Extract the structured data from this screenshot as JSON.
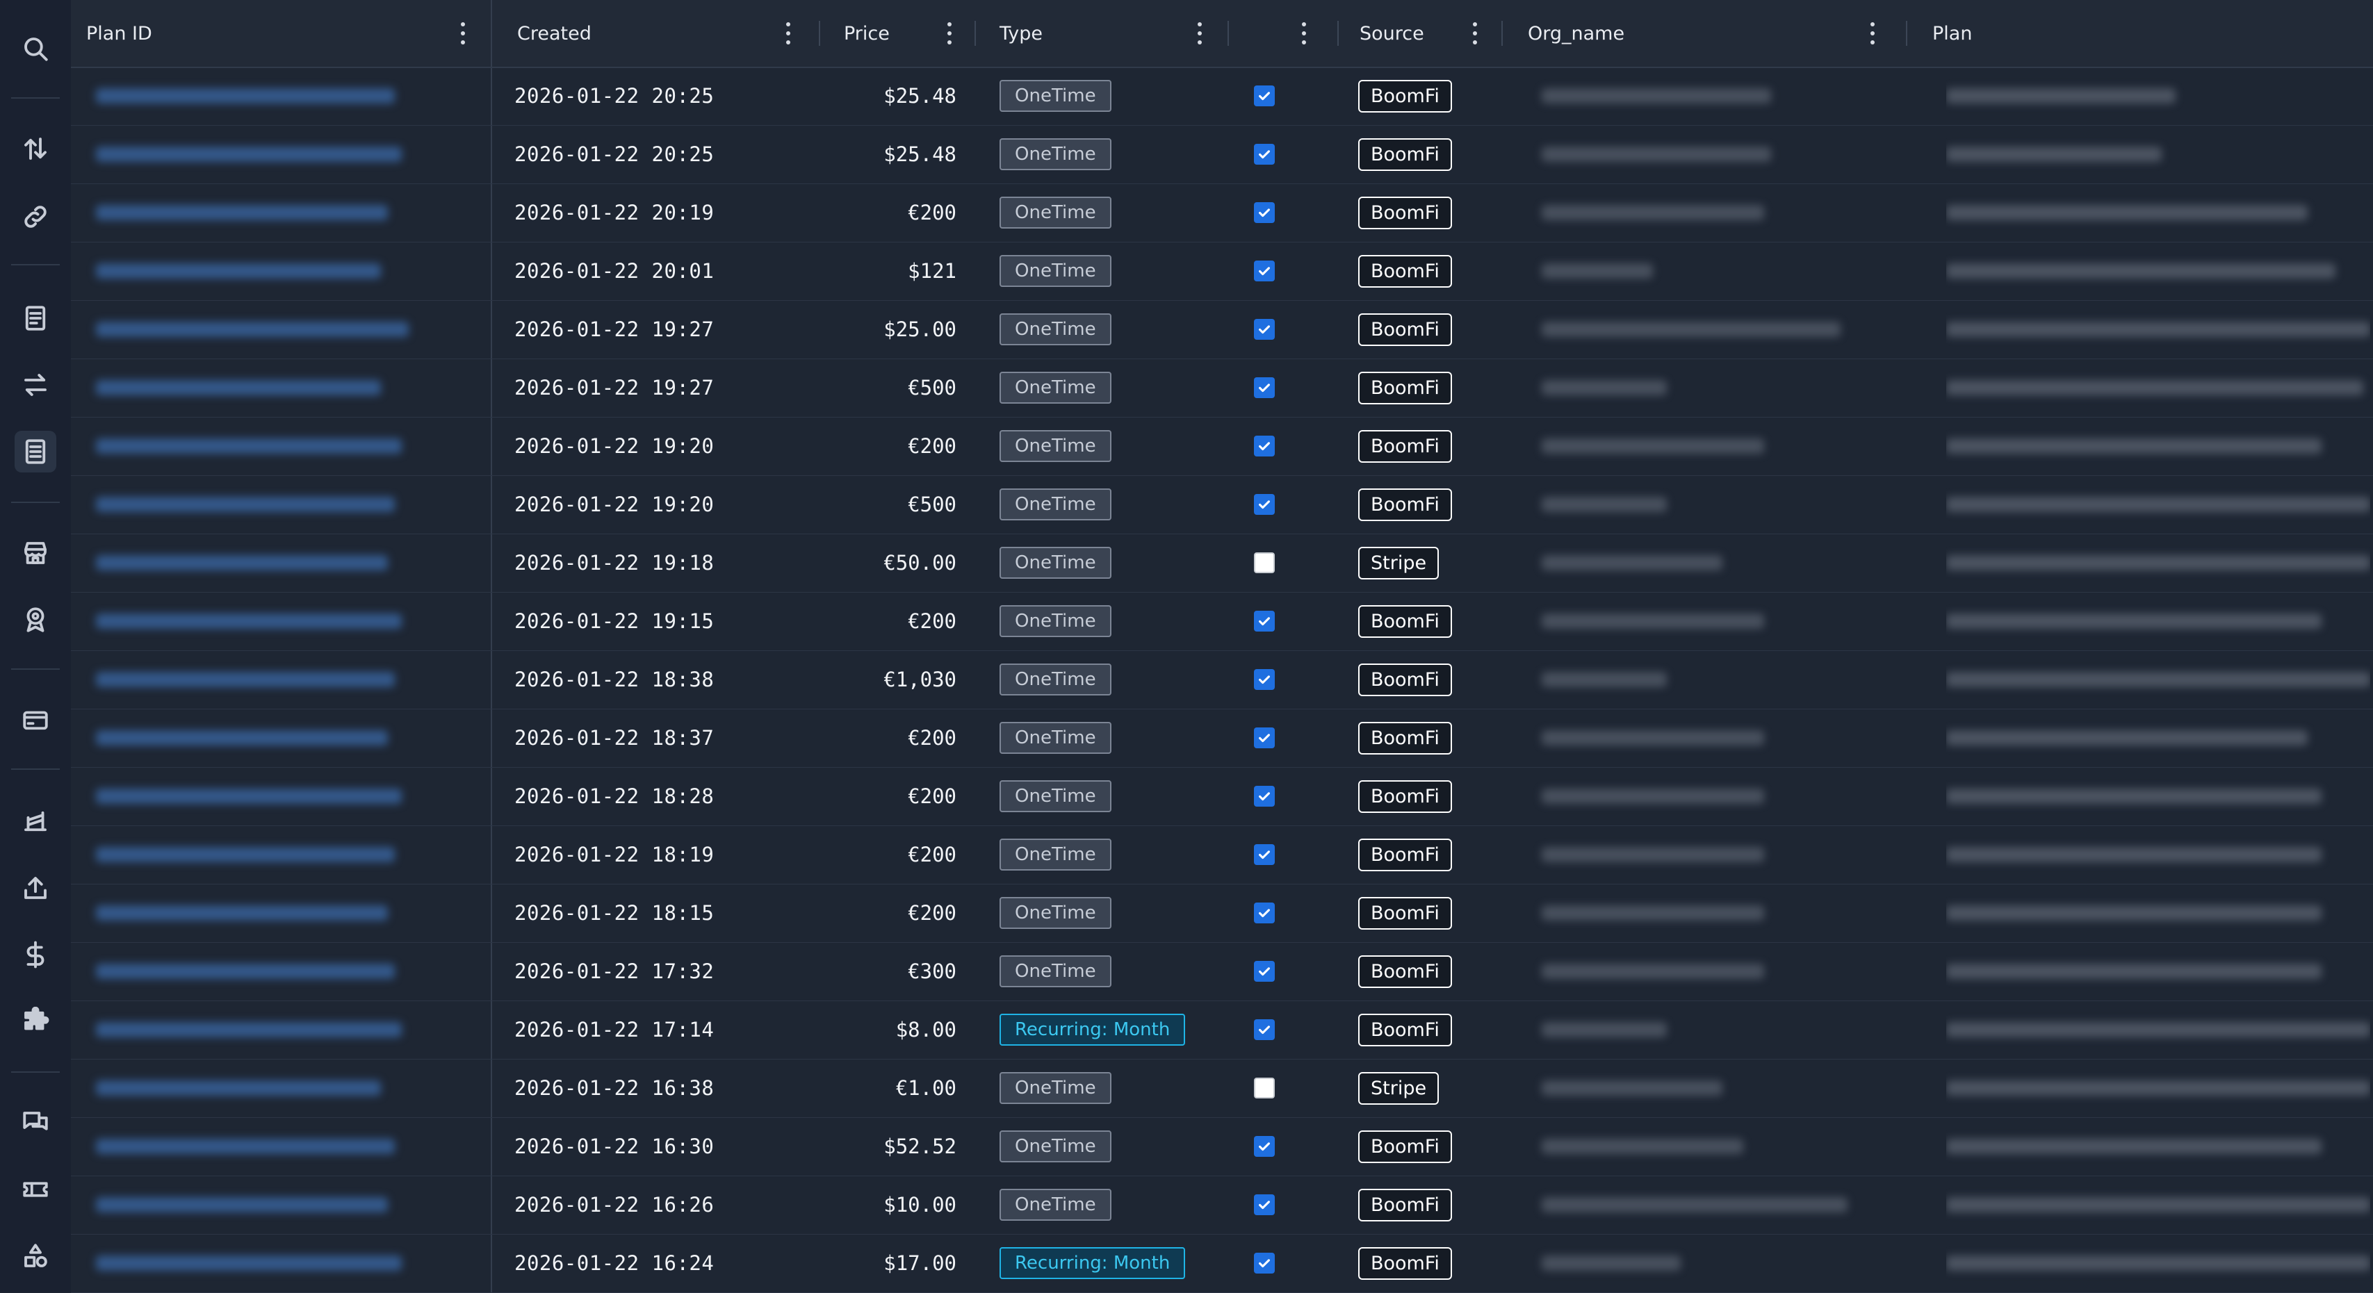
{
  "rail": {
    "icons": [
      "search-icon",
      "sort-arrows-icon",
      "link-icon",
      "invoice-icon",
      "swap-icon",
      "receipt-icon",
      "store-icon",
      "badge-icon",
      "card-icon",
      "stack-icon",
      "upload-icon",
      "dollar-icon",
      "puzzle-icon",
      "chat-icon",
      "ticket-icon",
      "shapes-icon"
    ]
  },
  "columns": {
    "plan_id": "Plan ID",
    "created": "Created",
    "price": "Price",
    "type": "Type",
    "checked": "",
    "source": "Source",
    "org_name": "Org_name",
    "plan": "Plan"
  },
  "colors": {
    "background": "#1e2633",
    "recurring_accent": "#1fb4e6",
    "checkbox_blue": "#1f6fe0"
  },
  "rows": [
    {
      "created": "2026-01-22 20:25",
      "price": "$25.48",
      "type": "OneTime",
      "checked": true,
      "source": "BoomFi"
    },
    {
      "created": "2026-01-22 20:25",
      "price": "$25.48",
      "type": "OneTime",
      "checked": true,
      "source": "BoomFi"
    },
    {
      "created": "2026-01-22 20:19",
      "price": "€200",
      "type": "OneTime",
      "checked": true,
      "source": "BoomFi"
    },
    {
      "created": "2026-01-22 20:01",
      "price": "$121",
      "type": "OneTime",
      "checked": true,
      "source": "BoomFi"
    },
    {
      "created": "2026-01-22 19:27",
      "price": "$25.00",
      "type": "OneTime",
      "checked": true,
      "source": "BoomFi"
    },
    {
      "created": "2026-01-22 19:27",
      "price": "€500",
      "type": "OneTime",
      "checked": true,
      "source": "BoomFi"
    },
    {
      "created": "2026-01-22 19:20",
      "price": "€200",
      "type": "OneTime",
      "checked": true,
      "source": "BoomFi"
    },
    {
      "created": "2026-01-22 19:20",
      "price": "€500",
      "type": "OneTime",
      "checked": true,
      "source": "BoomFi"
    },
    {
      "created": "2026-01-22 19:18",
      "price": "€50.00",
      "type": "OneTime",
      "checked": false,
      "source": "Stripe"
    },
    {
      "created": "2026-01-22 19:15",
      "price": "€200",
      "type": "OneTime",
      "checked": true,
      "source": "BoomFi"
    },
    {
      "created": "2026-01-22 18:38",
      "price": "€1,030",
      "type": "OneTime",
      "checked": true,
      "source": "BoomFi"
    },
    {
      "created": "2026-01-22 18:37",
      "price": "€200",
      "type": "OneTime",
      "checked": true,
      "source": "BoomFi"
    },
    {
      "created": "2026-01-22 18:28",
      "price": "€200",
      "type": "OneTime",
      "checked": true,
      "source": "BoomFi"
    },
    {
      "created": "2026-01-22 18:19",
      "price": "€200",
      "type": "OneTime",
      "checked": true,
      "source": "BoomFi"
    },
    {
      "created": "2026-01-22 18:15",
      "price": "€200",
      "type": "OneTime",
      "checked": true,
      "source": "BoomFi"
    },
    {
      "created": "2026-01-22 17:32",
      "price": "€300",
      "type": "OneTime",
      "checked": true,
      "source": "BoomFi"
    },
    {
      "created": "2026-01-22 17:14",
      "price": "$8.00",
      "type": "Recurring: Month",
      "checked": true,
      "source": "BoomFi"
    },
    {
      "created": "2026-01-22 16:38",
      "price": "€1.00",
      "type": "OneTime",
      "checked": false,
      "source": "Stripe"
    },
    {
      "created": "2026-01-22 16:30",
      "price": "$52.52",
      "type": "OneTime",
      "checked": true,
      "source": "BoomFi"
    },
    {
      "created": "2026-01-22 16:26",
      "price": "$10.00",
      "type": "OneTime",
      "checked": true,
      "source": "BoomFi"
    },
    {
      "created": "2026-01-22 16:24",
      "price": "$17.00",
      "type": "Recurring: Month",
      "checked": true,
      "source": "BoomFi"
    }
  ]
}
